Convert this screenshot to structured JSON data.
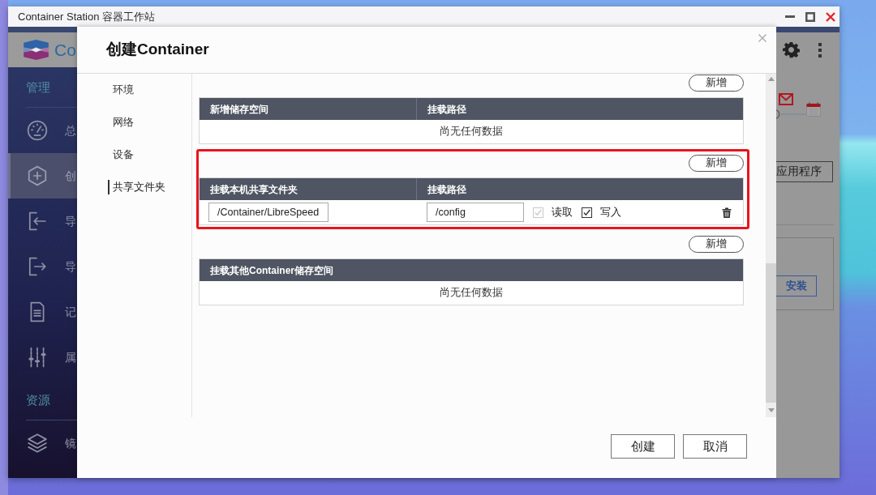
{
  "window": {
    "title": "Container Station 容器工作站"
  },
  "app": {
    "brand": "Co",
    "sidebar": [
      {
        "heading": "管理",
        "items": [
          {
            "label": "总",
            "selected": false
          },
          {
            "label": "创",
            "selected": true
          },
          {
            "label": "导",
            "selected": false
          },
          {
            "label": "导",
            "selected": false
          },
          {
            "label": "记",
            "selected": false
          },
          {
            "label": "属",
            "selected": false
          }
        ]
      },
      {
        "heading": "资源",
        "items": [
          {
            "label": "镜",
            "selected": false
          }
        ]
      }
    ],
    "apps_button": "应用程序",
    "install_button": "安装"
  },
  "dialog": {
    "title": "创建Container",
    "nav": [
      {
        "label": "环境",
        "selected": false
      },
      {
        "label": "网络",
        "selected": false
      },
      {
        "label": "设备",
        "selected": false
      },
      {
        "label": "共享文件夹",
        "selected": true
      }
    ],
    "sections": [
      {
        "add_button": "新增",
        "highlighted": false,
        "columns": [
          "新增储存空间",
          "挂载路径"
        ],
        "empty_text": "尚无任何数据"
      },
      {
        "add_button": "新增",
        "highlighted": true,
        "columns": [
          "挂载本机共享文件夹",
          "挂载路径"
        ],
        "rows": [
          {
            "host_path": "/Container/LibreSpeed",
            "mount_path": "/config",
            "permissions": [
              {
                "label": "读取",
                "checked": true,
                "disabled": true
              },
              {
                "label": "写入",
                "checked": true,
                "disabled": false
              }
            ]
          }
        ]
      },
      {
        "add_button": "新增",
        "highlighted": false,
        "columns": [
          "挂载其他Container储存空间"
        ],
        "empty_text": "尚无任何数据"
      }
    ],
    "buttons": [
      "创建",
      "取消"
    ]
  }
}
